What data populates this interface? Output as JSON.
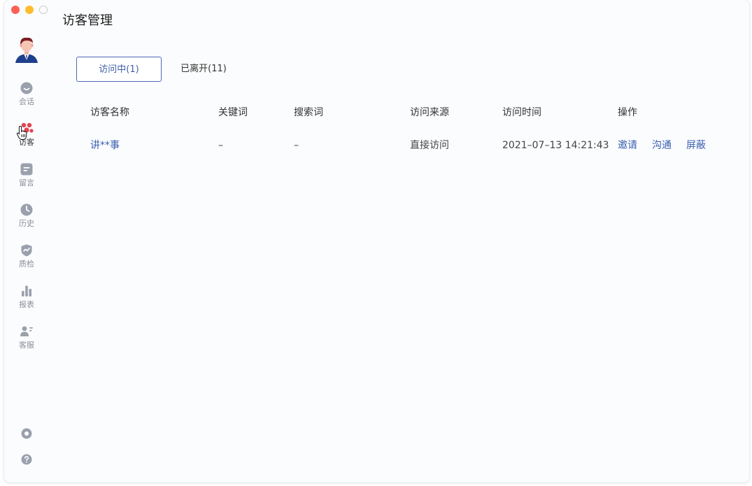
{
  "window": {
    "controls": [
      "close",
      "minimize",
      "maximize"
    ]
  },
  "sidebar": {
    "avatar_icon": "avatar-illustration",
    "items": [
      {
        "id": "sessions",
        "label": "会话",
        "icon": "chat-bubble-icon",
        "active": false
      },
      {
        "id": "visitors",
        "label": "访客",
        "icon": "visitors-icon",
        "active": true
      },
      {
        "id": "messages",
        "label": "留言",
        "icon": "message-note-icon",
        "active": false
      },
      {
        "id": "history",
        "label": "历史",
        "icon": "clock-icon",
        "active": false
      },
      {
        "id": "quality",
        "label": "质检",
        "icon": "shield-check-icon",
        "active": false
      },
      {
        "id": "reports",
        "label": "报表",
        "icon": "bar-chart-icon",
        "active": false
      },
      {
        "id": "agents",
        "label": "客服",
        "icon": "agent-list-icon",
        "active": false
      }
    ],
    "bottom_icons": [
      "settings-icon",
      "help-icon"
    ]
  },
  "header": {
    "title": "访客管理"
  },
  "tabs": [
    {
      "label": "访问中(1)",
      "active": true
    },
    {
      "label": "已离开(11)",
      "active": false
    }
  ],
  "table": {
    "columns": [
      "访客名称",
      "关键词",
      "搜索词",
      "访问来源",
      "访问时间",
      "操作"
    ],
    "rows": [
      {
        "name": "讲**事",
        "keyword": "–",
        "search": "–",
        "source": "直接访问",
        "time": "2021–07–13 14:21:43",
        "actions": [
          "邀请",
          "沟通",
          "屏蔽"
        ]
      }
    ]
  },
  "colors": {
    "accent": "#3a5fb0",
    "tab_border": "#4b6ab8",
    "icon_gray": "#9aa0ac",
    "visitor_red": "#e0464f",
    "background": "#fbfcfe"
  }
}
